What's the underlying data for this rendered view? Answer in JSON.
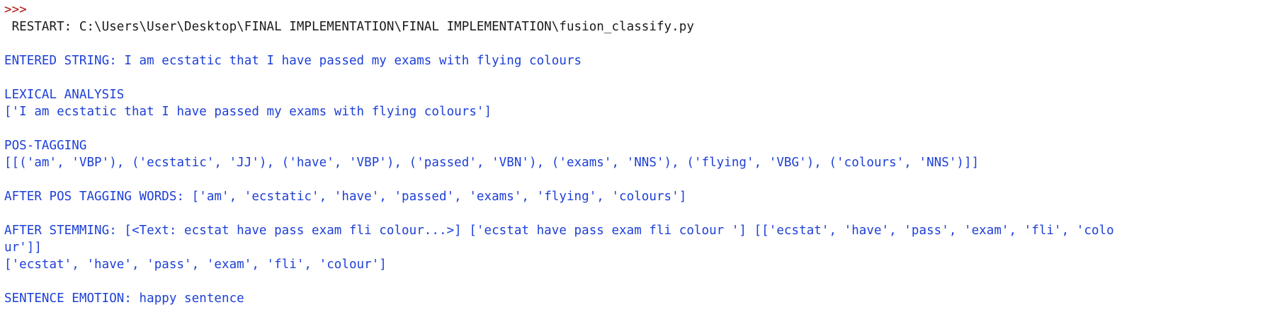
{
  "shell": {
    "prompt": ">>>",
    "restart": " RESTART: C:\\Users\\User\\Desktop\\FINAL IMPLEMENTATION\\FINAL IMPLEMENTATION\\fusion_classify.py",
    "entered_string": "ENTERED STRING: I am ecstatic that I have passed my exams with flying colours",
    "lexical_heading": "LEXICAL ANALYSIS",
    "lexical_value": "['I am ecstatic that I have passed my exams with flying colours']",
    "pos_heading": "POS-TAGGING",
    "pos_value": "[[('am', 'VBP'), ('ecstatic', 'JJ'), ('have', 'VBP'), ('passed', 'VBN'), ('exams', 'NNS'), ('flying', 'VBG'), ('colours', 'NNS')]]",
    "after_pos": "AFTER POS TAGGING WORDS: ['am', 'ecstatic', 'have', 'passed', 'exams', 'flying', 'colours']",
    "stemming_line1": "AFTER STEMMING: [<Text: ecstat have pass exam fli colour...>] ['ecstat have pass exam fli colour '] [['ecstat', 'have', 'pass', 'exam', 'fli', 'colo",
    "stemming_line2": "ur']]",
    "stemming_line3": "['ecstat', 'have', 'pass', 'exam', 'fli', 'colour']",
    "emotion": "SENTENCE EMOTION: happy sentence"
  },
  "colors": {
    "prompt": "#b01212",
    "output": "#1d3fd6",
    "restart": "#1a1a1a",
    "background": "#ffffff"
  }
}
